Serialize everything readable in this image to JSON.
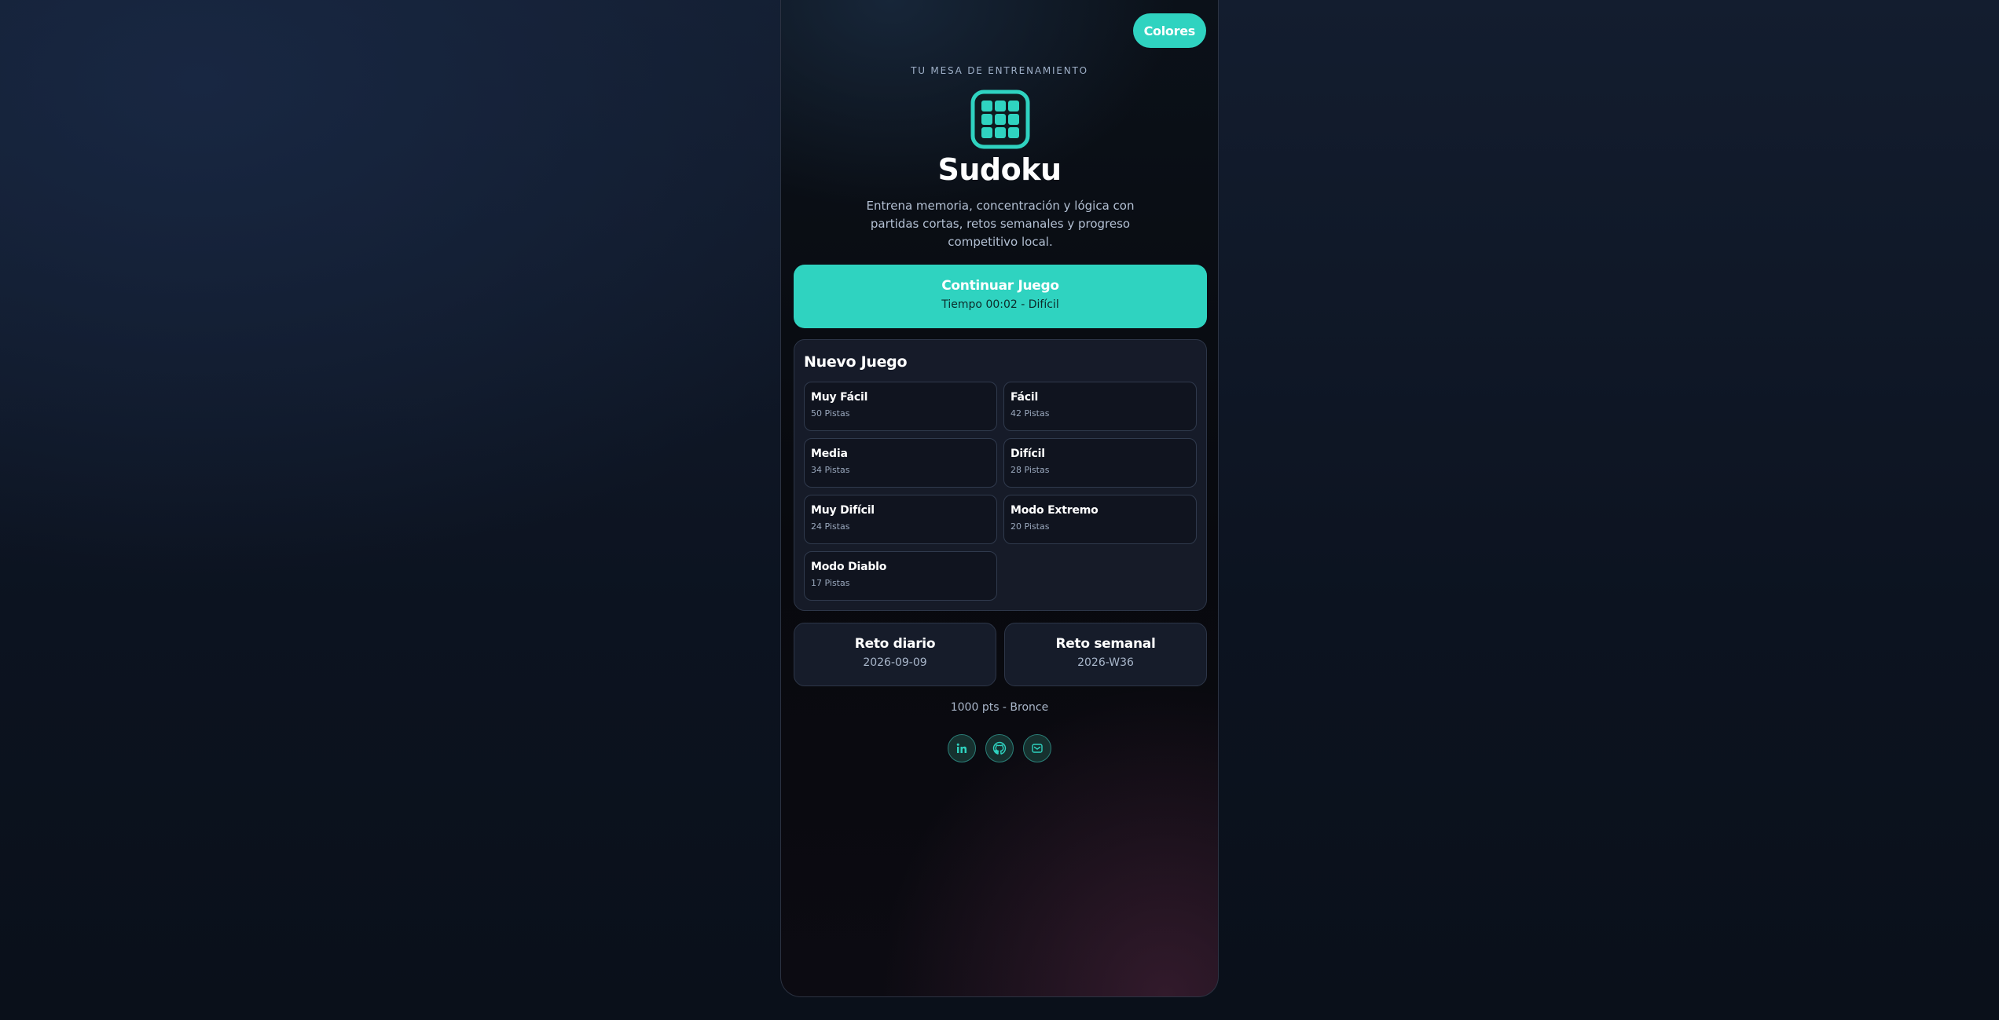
{
  "header": {
    "colors_button": "Colores",
    "kicker": "TU MESA DE ENTRENAMIENTO",
    "title": "Sudoku",
    "subtitle": "Entrena memoria, concentración y lógica con partidas cortas, retos semanales y progreso competitivo local.",
    "logo_icon": "grid-icon"
  },
  "continue_game": {
    "label": "Continuar Juego",
    "status": "Tiempo 00:02 - Difícil"
  },
  "new_game": {
    "title": "Nuevo Juego",
    "difficulties": [
      {
        "name": "Muy Fácil",
        "clues": "50 Pistas"
      },
      {
        "name": "Fácil",
        "clues": "42 Pistas"
      },
      {
        "name": "Media",
        "clues": "34 Pistas"
      },
      {
        "name": "Difícil",
        "clues": "28 Pistas"
      },
      {
        "name": "Muy Difícil",
        "clues": "24 Pistas"
      },
      {
        "name": "Modo Extremo",
        "clues": "20 Pistas"
      },
      {
        "name": "Modo Diablo",
        "clues": "17 Pistas"
      }
    ]
  },
  "challenges": {
    "daily": {
      "title": "Reto diario",
      "value": "2026-09-09"
    },
    "weekly": {
      "title": "Reto semanal",
      "value": "2026-W36"
    }
  },
  "score": {
    "text": "1000 pts - Bronce"
  },
  "socials": {
    "icons": [
      "linkedin-icon",
      "github-icon",
      "mail-icon"
    ]
  },
  "colors": {
    "accent": "#2fd3c0",
    "panel": "#181e2c",
    "text": "#ffffff",
    "muted": "#9aa8bd"
  }
}
